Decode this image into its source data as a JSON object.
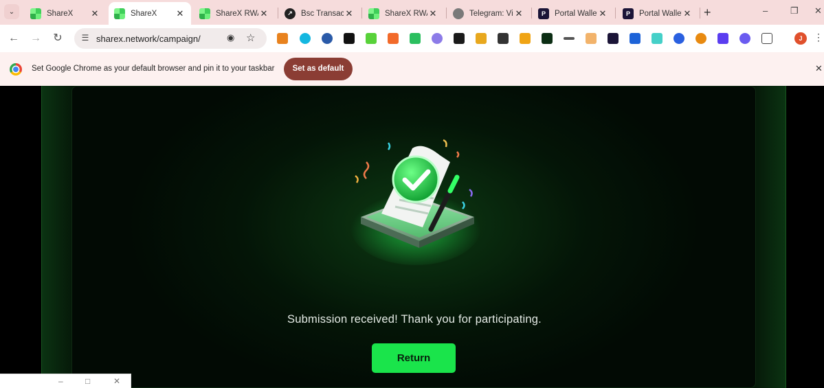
{
  "browser": {
    "tabs": [
      {
        "title": "ShareX",
        "favicon": "sharex-icon",
        "active": false
      },
      {
        "title": "ShareX",
        "favicon": "sharex-icon",
        "active": true
      },
      {
        "title": "ShareX RWA",
        "favicon": "sharex-icon",
        "active": false
      },
      {
        "title": "Bsc Transacti",
        "favicon": "bscscan-icon",
        "active": false
      },
      {
        "title": "ShareX RWA",
        "favicon": "sharex-icon",
        "active": false
      },
      {
        "title": "Telegram: Vi",
        "favicon": "telegram-icon",
        "active": false
      },
      {
        "title": "Portal Wallet",
        "favicon": "portal-icon",
        "active": false
      },
      {
        "title": "Portal Wallet",
        "favicon": "portal-icon",
        "active": false
      }
    ],
    "new_tab": "+",
    "url": "sharex.network/campaign/",
    "profile_initial": "J",
    "infobar": {
      "message": "Set Google Chrome as your default browser and pin it to your taskbar",
      "button": "Set as default"
    }
  },
  "page": {
    "message": "Submission received! Thank you for participating.",
    "return_button": "Return"
  },
  "colors": {
    "accent_green": "#1ae44b",
    "infobar_button": "#8b3d34",
    "tabstrip": "#f6dcdc"
  }
}
